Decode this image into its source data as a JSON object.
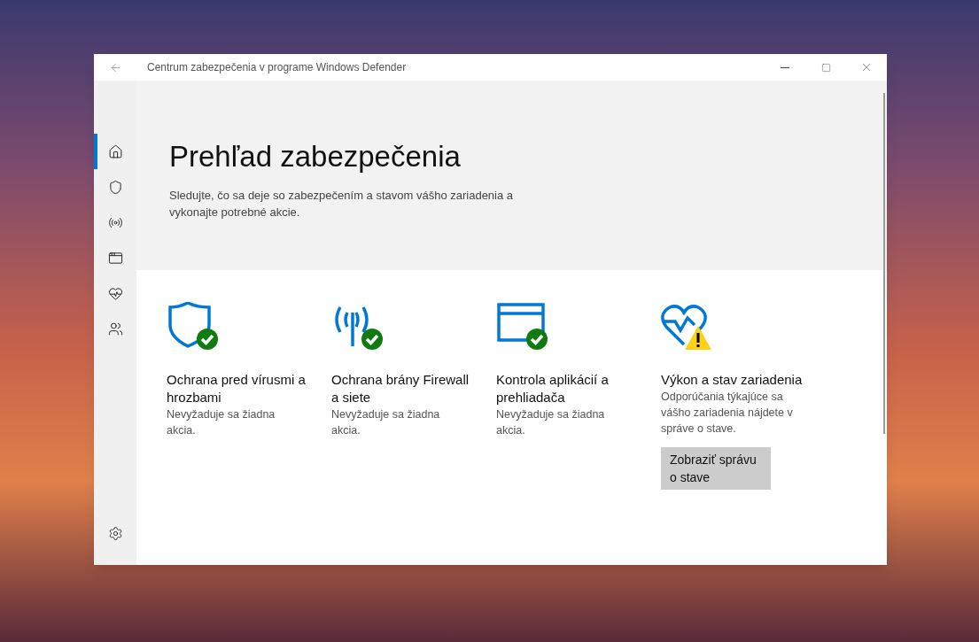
{
  "window": {
    "title": "Centrum zabezpečenia v programe Windows Defender"
  },
  "sidebar": {
    "items": [
      {
        "kind": "home",
        "selected": true
      },
      {
        "kind": "shield",
        "selected": false
      },
      {
        "kind": "network",
        "selected": false
      },
      {
        "kind": "app",
        "selected": false
      },
      {
        "kind": "health",
        "selected": false
      },
      {
        "kind": "family",
        "selected": false
      }
    ],
    "settings": {
      "kind": "settings"
    }
  },
  "header": {
    "title": "Prehľad zabezpečenia",
    "subtitle": "Sledujte, čo sa deje so zabezpečením a stavom vášho zariadenia a vykonajte potrebné akcie."
  },
  "cards": [
    {
      "kind": "shield",
      "warning": false,
      "title": "Ochrana pred vírusmi a hrozbami",
      "description": "Nevyžaduje sa žiadna akcia."
    },
    {
      "kind": "network",
      "warning": false,
      "title": "Ochrana brány Firewall a siete",
      "description": "Nevyžaduje sa žiadna akcia."
    },
    {
      "kind": "app",
      "warning": false,
      "title": "Kontrola aplikácií a prehliadača",
      "description": "Nevyžaduje sa žiadna akcia."
    },
    {
      "kind": "health",
      "warning": true,
      "title": "Výkon a stav zariadenia",
      "description": "Odporúčania týkajúce sa vášho zariadenia nájdete v správe o stave.",
      "button": "Zobraziť správu o stave"
    }
  ]
}
